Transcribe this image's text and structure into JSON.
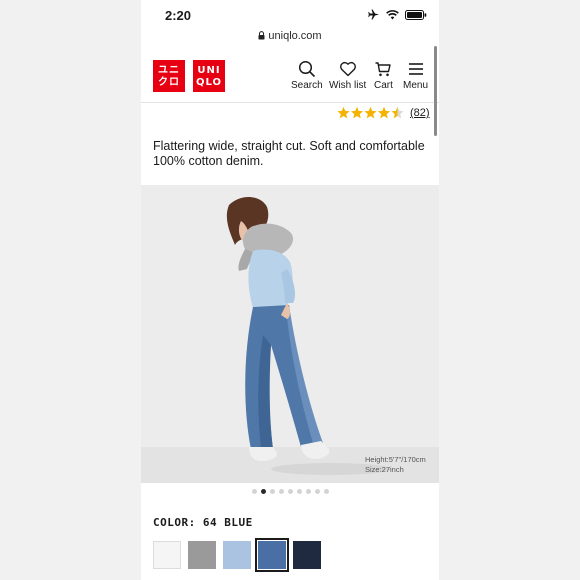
{
  "status_bar": {
    "time": "2:20"
  },
  "url_bar": {
    "domain": "uniqlo.com"
  },
  "header": {
    "logo_left": [
      "ユニ",
      "クロ"
    ],
    "logo_right": [
      "UNI",
      "QLO"
    ],
    "nav": [
      {
        "label": "Search",
        "icon": "search-icon"
      },
      {
        "label": "Wish list",
        "icon": "heart-icon"
      },
      {
        "label": "Cart",
        "icon": "cart-icon"
      },
      {
        "label": "Menu",
        "icon": "hamburger-icon"
      }
    ]
  },
  "rating": {
    "stars": 4.5,
    "count": "(82)",
    "star_color": "#f5b301"
  },
  "product": {
    "description": "Flattering wide, straight cut. Soft and comfortable 100% cotton denim.",
    "model_height": "Height:5'7\"/170cm",
    "model_size": "Size:27inch"
  },
  "carousel": {
    "total": 9,
    "active_index": 1
  },
  "color": {
    "label": "COLOR: 64 BLUE",
    "swatches": [
      {
        "name": "white",
        "color": "#f5f5f5",
        "selected": false
      },
      {
        "name": "gray",
        "color": "#9a9a9a",
        "selected": false
      },
      {
        "name": "light-blue",
        "color": "#a9c3e0",
        "selected": false
      },
      {
        "name": "blue",
        "color": "#4a6fa5",
        "selected": true
      },
      {
        "name": "navy",
        "color": "#1f2a40",
        "selected": false
      }
    ]
  }
}
